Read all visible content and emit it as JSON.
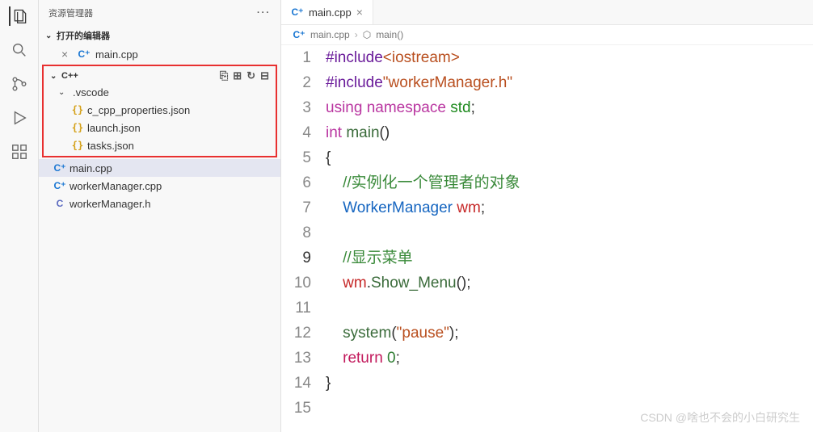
{
  "sidebar": {
    "title": "资源管理器",
    "openEditors": {
      "label": "打开的编辑器",
      "items": [
        {
          "name": "main.cpp"
        }
      ]
    },
    "project": {
      "name": "C++",
      "folders": [
        {
          "name": ".vscode",
          "files": [
            {
              "name": "c_cpp_properties.json",
              "type": "json"
            },
            {
              "name": "launch.json",
              "type": "json"
            },
            {
              "name": "tasks.json",
              "type": "json"
            }
          ]
        }
      ],
      "files": [
        {
          "name": "main.cpp",
          "type": "cpp",
          "selected": true
        },
        {
          "name": "workerManager.cpp",
          "type": "cpp"
        },
        {
          "name": "workerManager.h",
          "type": "c"
        }
      ]
    }
  },
  "editor": {
    "tab": {
      "name": "main.cpp"
    },
    "breadcrumb": {
      "file": "main.cpp",
      "symbol": "main()"
    },
    "currentLine": 9,
    "code": [
      {
        "n": 1,
        "tokens": [
          [
            "inc",
            "#include"
          ],
          [
            "str",
            "<iostream>"
          ]
        ]
      },
      {
        "n": 2,
        "tokens": [
          [
            "inc",
            "#include"
          ],
          [
            "str",
            "\"workerManager.h\""
          ]
        ]
      },
      {
        "n": 3,
        "tokens": [
          [
            "kw",
            "using "
          ],
          [
            "kw",
            "namespace "
          ],
          [
            "ns",
            "std"
          ],
          [
            "op",
            ";"
          ]
        ]
      },
      {
        "n": 4,
        "tokens": [
          [
            "kw",
            "int "
          ],
          [
            "fn",
            "main"
          ],
          [
            "op",
            "()"
          ]
        ]
      },
      {
        "n": 5,
        "tokens": [
          [
            "brace",
            "{"
          ]
        ]
      },
      {
        "n": 6,
        "tokens": [
          [
            "op",
            "    "
          ],
          [
            "comment",
            "//实例化一个管理者的对象"
          ]
        ]
      },
      {
        "n": 7,
        "tokens": [
          [
            "op",
            "    "
          ],
          [
            "type",
            "WorkerManager"
          ],
          [
            "op",
            " "
          ],
          [
            "var",
            "wm"
          ],
          [
            "op",
            ";"
          ]
        ]
      },
      {
        "n": 8,
        "tokens": []
      },
      {
        "n": 9,
        "tokens": [
          [
            "op",
            "    "
          ],
          [
            "comment",
            "//显示菜单"
          ]
        ]
      },
      {
        "n": 10,
        "tokens": [
          [
            "op",
            "    "
          ],
          [
            "var",
            "wm"
          ],
          [
            "op",
            "."
          ],
          [
            "fn",
            "Show_Menu"
          ],
          [
            "op",
            "();"
          ]
        ]
      },
      {
        "n": 11,
        "tokens": []
      },
      {
        "n": 12,
        "tokens": [
          [
            "op",
            "    "
          ],
          [
            "fn",
            "system"
          ],
          [
            "op",
            "("
          ],
          [
            "str",
            "\"pause\""
          ],
          [
            "op",
            ");"
          ]
        ]
      },
      {
        "n": 13,
        "tokens": [
          [
            "op",
            "    "
          ],
          [
            "ret",
            "return "
          ],
          [
            "num",
            "0"
          ],
          [
            "op",
            ";"
          ]
        ]
      },
      {
        "n": 14,
        "tokens": [
          [
            "brace",
            "}"
          ]
        ]
      },
      {
        "n": 15,
        "tokens": []
      }
    ]
  },
  "watermark": "CSDN @啥也不会的小白研究生"
}
